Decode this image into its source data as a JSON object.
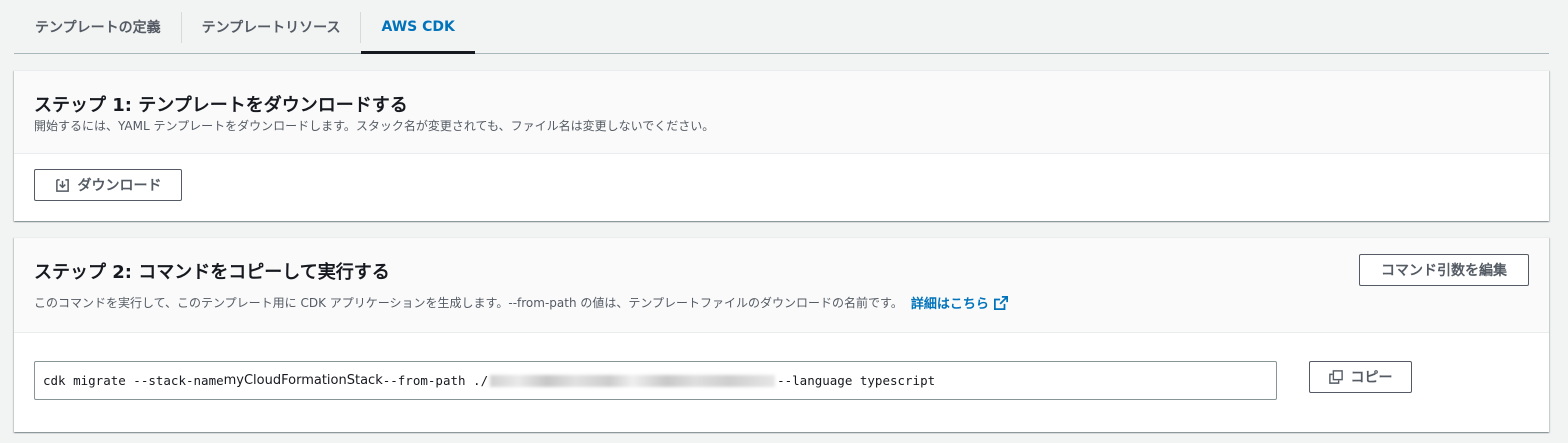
{
  "tabs": [
    {
      "label": "テンプレートの定義"
    },
    {
      "label": "テンプレートリソース"
    },
    {
      "label": "AWS CDK"
    }
  ],
  "step1": {
    "title": "ステップ 1: テンプレートをダウンロードする",
    "description": "開始するには、YAML テンプレートをダウンロードします。スタック名が変更されても、ファイル名は変更しないでください。",
    "download_button": "ダウンロード"
  },
  "step2": {
    "title": "ステップ 2: コマンドをコピーして実行する",
    "description": "このコマンドを実行して、このテンプレート用に CDK アプリケーションを生成します。--from-path の値は、テンプレートファイルのダウンロードの名前です。",
    "learn_more": "詳細はこちら",
    "edit_button": "コマンド引数を編集",
    "copy_button": "コピー",
    "command": {
      "prefix": "cdk migrate --stack-name ",
      "stack_name": "myCloudFormationStack",
      "from_path": " --from-path ./",
      "suffix": " --language typescript"
    }
  },
  "colors": {
    "accent": "#0073bb",
    "text": "#16191f",
    "muted": "#545b64",
    "background": "#f2f3f3"
  }
}
